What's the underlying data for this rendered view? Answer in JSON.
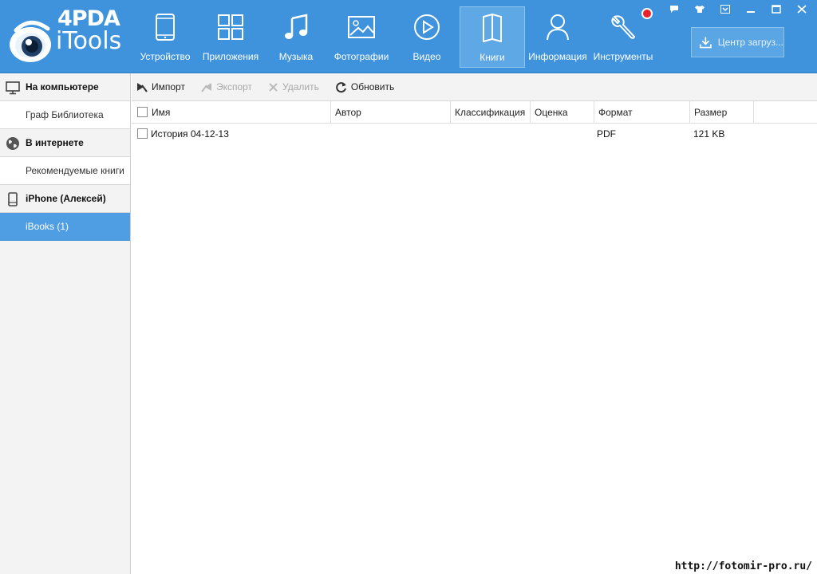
{
  "app": {
    "brand_top": "4PDA",
    "brand_name": "iTools",
    "accent_color": "#3f93dc"
  },
  "nav": {
    "items": [
      {
        "label": "Устройство",
        "icon": "phone-icon"
      },
      {
        "label": "Приложения",
        "icon": "apps-grid-icon"
      },
      {
        "label": "Музыка",
        "icon": "music-note-icon"
      },
      {
        "label": "Фотографии",
        "icon": "picture-icon"
      },
      {
        "label": "Видео",
        "icon": "play-circle-icon"
      },
      {
        "label": "Книги",
        "icon": "book-icon",
        "active": true
      },
      {
        "label": "Информация",
        "icon": "user-icon"
      },
      {
        "label": "Инструменты",
        "icon": "wrench-icon"
      }
    ],
    "download_center": "Центр загруз..."
  },
  "sidebar": {
    "sections": [
      {
        "heading": "На компьютере",
        "icon": "monitor-icon",
        "items": [
          "Граф Библиотека"
        ]
      },
      {
        "heading": "В интернете",
        "icon": "globe-icon",
        "items": [
          "Рекомендуемые книги"
        ]
      },
      {
        "heading": "iPhone (Алексей)",
        "icon": "phone-icon",
        "items": [
          "iBooks (1)"
        ]
      }
    ]
  },
  "toolbar": {
    "import": "Импорт",
    "export": "Экспорт",
    "delete": "Удалить",
    "refresh": "Обновить"
  },
  "table": {
    "columns": [
      "Имя",
      "Автор",
      "Классификация",
      "Оценка",
      "Формат",
      "Размер"
    ],
    "rows": [
      {
        "name": "История 04-12-13",
        "author": "",
        "classification": "",
        "rating": "",
        "format": "PDF",
        "size": "121 KB"
      }
    ]
  },
  "watermark": "http://fotomir-pro.ru/"
}
